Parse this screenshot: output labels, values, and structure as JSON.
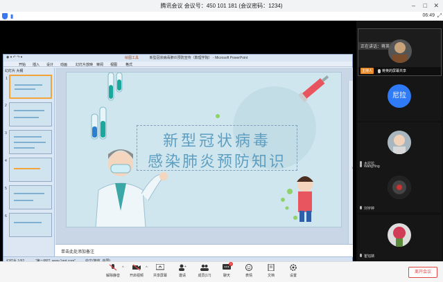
{
  "window": {
    "title": "腾讯会议 会议号：450 101 181  (会议密码：1234)",
    "time": "06:49"
  },
  "ppt": {
    "window_title": "新型冠状病毒肺炎预防宣传（数理学院） - Microsoft PowerPoint",
    "context_tab": "绘图工具",
    "ribbon_tabs": [
      "开始",
      "插入",
      "设计",
      "动画",
      "幻灯片放映",
      "审阅",
      "视图",
      "格式"
    ],
    "pane_tabs": "幻灯片  大纲",
    "thumb_numbers": [
      "1",
      "2",
      "3",
      "4",
      "5",
      "6"
    ],
    "slide_title_line1": "新型冠状病毒",
    "slide_title_line2": "感染肺炎预防知识",
    "notes_placeholder": "单击此处添加备注",
    "status": [
      "幻灯片 1/92",
      "\"第一PPT, www.1ppt.com\"",
      "中文(简体, 中国)"
    ]
  },
  "participants": {
    "speaking_label": "正在讲话：蒋英；",
    "host_badge": "主持人",
    "host_name": "蒋英的屏幕共享",
    "others": [
      {
        "name": "尼拉",
        "avatar_text": "尼拉",
        "avatar_color": "#2f7af6"
      },
      {
        "name": "木拉拉",
        "avatar_text": "",
        "avatar_color": "#9aa7b1"
      },
      {
        "name": "WangYing",
        "avatar_text": "",
        "avatar_color": "#3a3a3a"
      },
      {
        "name": "刘宇婷",
        "avatar_text": "",
        "avatar_color": "#7a8c5a"
      },
      {
        "name": "崔钰婧",
        "avatar_text": "",
        "avatar_color": "#2a2a2a"
      }
    ]
  },
  "toolbar": {
    "items": [
      "解除静音",
      "开启视频",
      "共享屏幕",
      "邀请",
      "成员(17)",
      "聊天",
      "表情",
      "文档",
      "设置"
    ],
    "chat_badge": "1",
    "leave": "离开会议"
  },
  "colors": {
    "accent": "#2f7af6",
    "danger": "#e04545",
    "host_badge": "#e98b2a"
  }
}
